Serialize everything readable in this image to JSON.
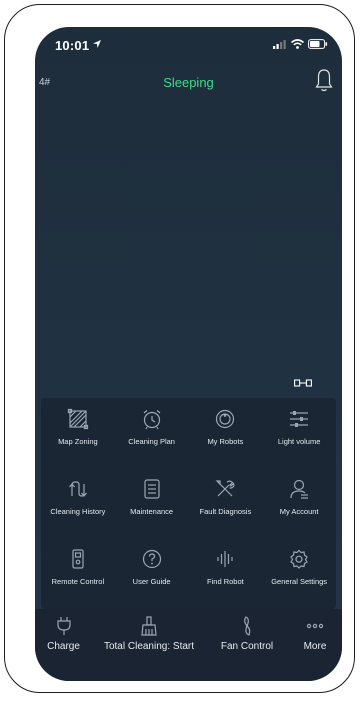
{
  "status_bar": {
    "time": "10:01"
  },
  "header": {
    "left_label": "4#",
    "status": "Sleeping"
  },
  "menu": {
    "items": [
      {
        "label": "Map Zoning",
        "icon": "map-zoning-icon"
      },
      {
        "label": "Cleaning Plan",
        "icon": "alarm-clock-icon"
      },
      {
        "label": "My Robots",
        "icon": "robot-icon"
      },
      {
        "label": "Light volume",
        "icon": "sliders-icon"
      },
      {
        "label": "Cleaning History",
        "icon": "history-icon"
      },
      {
        "label": "Maintenance",
        "icon": "document-icon"
      },
      {
        "label": "Fault Diagnosis",
        "icon": "tools-icon"
      },
      {
        "label": "My Account",
        "icon": "account-icon"
      },
      {
        "label": "Remote Control",
        "icon": "remote-icon"
      },
      {
        "label": "User Guide",
        "icon": "question-icon"
      },
      {
        "label": "Find Robot",
        "icon": "sound-wave-icon"
      },
      {
        "label": "General Settings",
        "icon": "settings-cog-icon"
      }
    ]
  },
  "bottom_bar": {
    "items": [
      {
        "label": "Charge",
        "icon": "plug-icon"
      },
      {
        "label": "Total Cleaning: Start",
        "icon": "broom-icon"
      },
      {
        "label": "Fan Control",
        "icon": "fan-icon"
      },
      {
        "label": "More",
        "icon": "more-dots-icon"
      }
    ]
  },
  "colors": {
    "status_green": "#3fdc8a",
    "background": "#1f3040",
    "panel": "#1a2634"
  }
}
